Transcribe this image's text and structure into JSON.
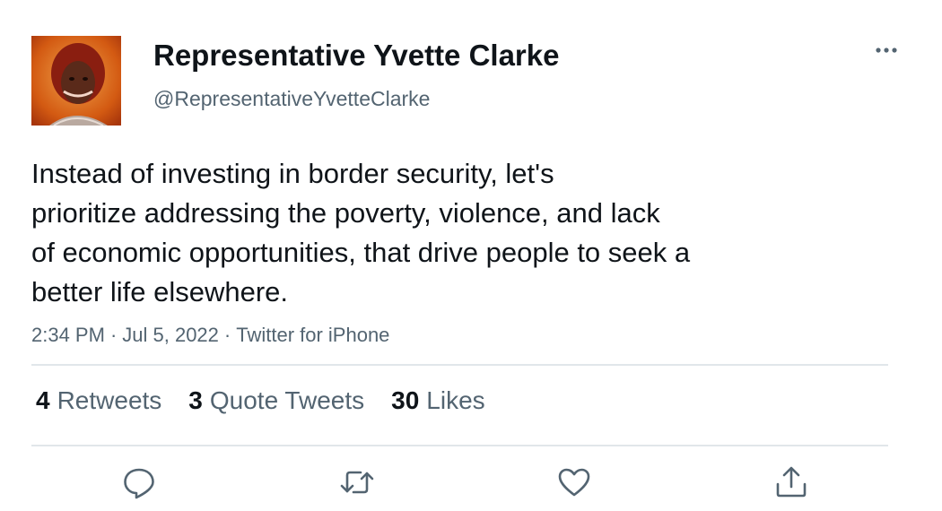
{
  "tweet": {
    "author": {
      "display_name": "Representative Yvette Clarke",
      "handle": "@RepresentativeYvetteClarke"
    },
    "text_lines": [
      "Instead of investing in border security, let's",
      "prioritize addressing the poverty, violence, and lack",
      "of economic opportunities, that drive people to seek a",
      "better life elsewhere."
    ],
    "time": "2:34 PM",
    "date": "Jul 5, 2022",
    "separator": "·",
    "source": "Twitter for iPhone",
    "stats": {
      "retweets_count": "4",
      "retweets_label": "Retweets",
      "quotes_count": "3",
      "quotes_label": "Quote Tweets",
      "likes_count": "30",
      "likes_label": "Likes"
    }
  },
  "icons": {
    "more": "more-horizontal-icon",
    "reply": "reply-icon",
    "retweet": "retweet-icon",
    "like": "heart-icon",
    "share": "share-icon"
  },
  "colors": {
    "text_primary": "#0f1419",
    "text_secondary": "#536471",
    "divider": "#e1e6ea"
  }
}
